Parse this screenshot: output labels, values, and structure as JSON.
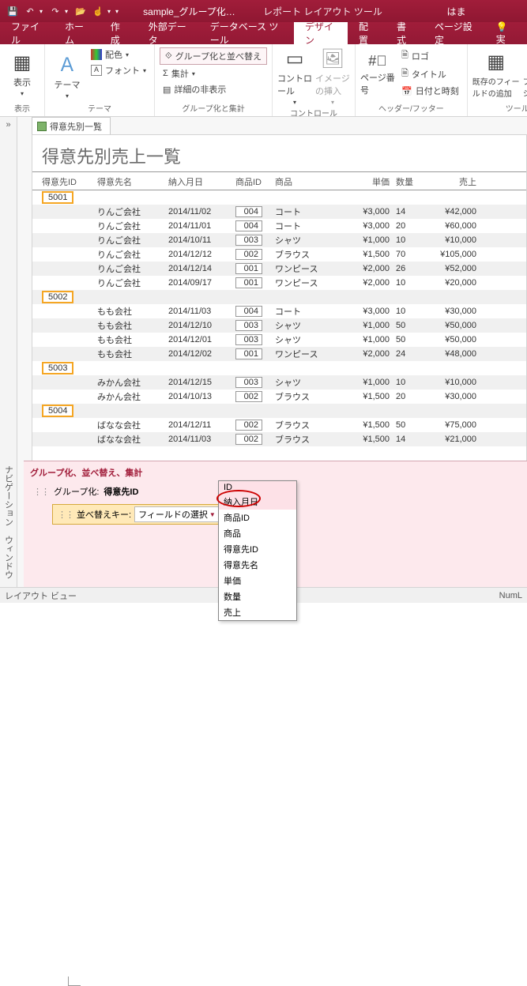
{
  "qat": {
    "title": "sample_グループ化…",
    "tool": "レポート レイアウト ツール",
    "app": "はま"
  },
  "tabs": [
    "ファイル",
    "ホーム",
    "作成",
    "外部データ",
    "データベース ツール",
    "デザイン",
    "配置",
    "書式",
    "ページ設定"
  ],
  "activeTab": 5,
  "ribbon": {
    "view": "表示",
    "themes": {
      "label": "テーマ",
      "theme": "テーマ",
      "colors": "配色",
      "fonts": "フォント"
    },
    "grouping": {
      "label": "グループ化と集計",
      "sort": "グループ化と並べ替え",
      "totals": "集計",
      "hide": "詳細の非表示"
    },
    "controls": {
      "label": "コントロール",
      "ctrl": "コントロール",
      "img": "イメージの挿入"
    },
    "header": {
      "label": "ヘッダー/フッター",
      "page": "ページ番号",
      "logo": "ロゴ",
      "title": "タイトル",
      "date": "日付と時刻"
    },
    "tools": {
      "label": "ツール",
      "fields": "既存のフィールドの追加",
      "prop": "プロパティシート"
    }
  },
  "nav": {
    "title": "ナビゲーション ウィンドウ"
  },
  "doc": {
    "tab": "得意先別一覧"
  },
  "report": {
    "title": "得意先別売上一覧",
    "cols": [
      "得意先ID",
      "得意先名",
      "納入月日",
      "商品ID",
      "商品",
      "単価",
      "数量",
      "売上"
    ],
    "groups": [
      {
        "id": "5001",
        "rows": [
          [
            "りんご会社",
            "2014/11/02",
            "004",
            "コート",
            "¥3,000",
            "14",
            "¥42,000"
          ],
          [
            "りんご会社",
            "2014/11/01",
            "004",
            "コート",
            "¥3,000",
            "20",
            "¥60,000"
          ],
          [
            "りんご会社",
            "2014/10/11",
            "003",
            "シャツ",
            "¥1,000",
            "10",
            "¥10,000"
          ],
          [
            "りんご会社",
            "2014/12/12",
            "002",
            "ブラウス",
            "¥1,500",
            "70",
            "¥105,000"
          ],
          [
            "りんご会社",
            "2014/12/14",
            "001",
            "ワンピース",
            "¥2,000",
            "26",
            "¥52,000"
          ],
          [
            "りんご会社",
            "2014/09/17",
            "001",
            "ワンピース",
            "¥2,000",
            "10",
            "¥20,000"
          ]
        ]
      },
      {
        "id": "5002",
        "rows": [
          [
            "もも会社",
            "2014/11/03",
            "004",
            "コート",
            "¥3,000",
            "10",
            "¥30,000"
          ],
          [
            "もも会社",
            "2014/12/10",
            "003",
            "シャツ",
            "¥1,000",
            "50",
            "¥50,000"
          ],
          [
            "もも会社",
            "2014/12/01",
            "003",
            "シャツ",
            "¥1,000",
            "50",
            "¥50,000"
          ],
          [
            "もも会社",
            "2014/12/02",
            "001",
            "ワンピース",
            "¥2,000",
            "24",
            "¥48,000"
          ]
        ]
      },
      {
        "id": "5003",
        "rows": [
          [
            "みかん会社",
            "2014/12/15",
            "003",
            "シャツ",
            "¥1,000",
            "10",
            "¥10,000"
          ],
          [
            "みかん会社",
            "2014/10/13",
            "002",
            "ブラウス",
            "¥1,500",
            "20",
            "¥30,000"
          ]
        ]
      },
      {
        "id": "5004",
        "rows": [
          [
            "ばなな会社",
            "2014/12/11",
            "002",
            "ブラウス",
            "¥1,500",
            "50",
            "¥75,000"
          ],
          [
            "ばなな会社",
            "2014/11/03",
            "002",
            "ブラウス",
            "¥1,500",
            "14",
            "¥21,000"
          ]
        ]
      }
    ]
  },
  "sort": {
    "title": "グループ化、並べ替え、集計",
    "groupBy": "グループ化:",
    "groupField": "得意先ID",
    "sortKey": "並べ替えキー:",
    "fieldSel": "フィールドの選択"
  },
  "dropdown": [
    "ID",
    "納入月日",
    "商品ID",
    "商品",
    "得意先ID",
    "得意先名",
    "単価",
    "数量",
    "売上"
  ],
  "status": {
    "left": "レイアウト ビュー",
    "right": "NumL"
  }
}
